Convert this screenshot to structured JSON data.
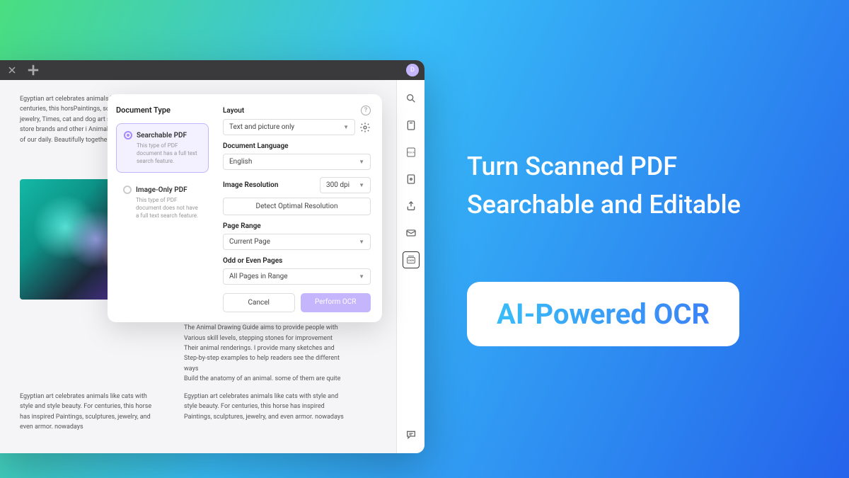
{
  "headline": {
    "line1": "Turn Scanned PDF",
    "line2": "Searchable and Editable"
  },
  "badge": "AI-Powered OCR",
  "avatar_letter": "D",
  "dialog": {
    "doc_type_title": "Document Type",
    "opt1": {
      "label": "Searchable PDF",
      "desc": "This type of PDF document has a full text search feature."
    },
    "opt2": {
      "label": "Image-Only PDF",
      "desc": "This type of PDF document does not have a full text search feature."
    },
    "layout_label": "Layout",
    "layout_value": "Text and picture only",
    "lang_label": "Document Language",
    "lang_value": "English",
    "res_label": "Image Resolution",
    "res_value": "300 dpi",
    "detect_label": "Detect Optimal Resolution",
    "range_label": "Page Range",
    "range_value": "Current Page",
    "oddeven_label": "Odd or Even Pages",
    "oddeven_value": "All Pages in Range",
    "cancel": "Cancel",
    "confirm": "Perform OCR"
  },
  "doc_text": {
    "para1": "Egyptian art celebrates animals beauty. For centuries, this horsPaintings, sculptures, jewelry, Times, cat and dog art sells a l Cups, store brands and other i Animals are a part of our daily. Beautifully together.",
    "para2": "Egyptian art celebrates animals like cats with style and style beauty. For centuries, this horse has inspired Paintings, sculptures, jewelry, and even armor. nowadays",
    "para3": "Animals are a part of our daily life. the combination of the two Beautifully together.\nThis combination is the subject of this book. artist's\nThe Animal Drawing Guide aims to provide people with\nVarious skill levels, stepping stones for improvement\nTheir animal renderings. I provide many sketches and\nStep-by-step examples to help readers see the different ways\nBuild the anatomy of an animal. some of them are quite",
    "para4": "Egyptian art celebrates animals like cats with style and style beauty. For centuries, this horse has inspired Paintings, sculptures, jewelry, and even armor. nowadays"
  }
}
